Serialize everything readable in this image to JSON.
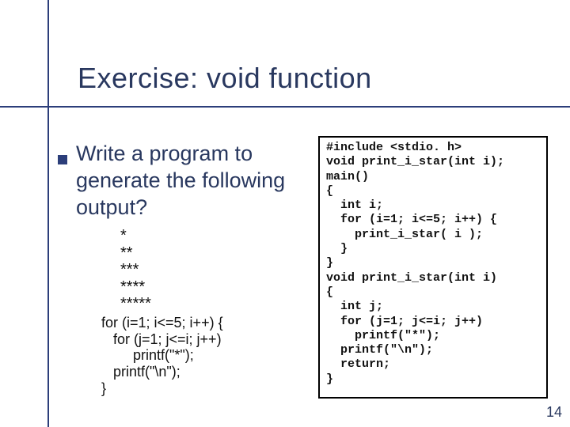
{
  "title": "Exercise: void function",
  "problem_text": "Write a program to generate the following output?",
  "stars_output": "*\n**\n***\n****\n*****",
  "left_snippet": "for (i=1; i<=5; i++) {\n   for (j=1; j<=i; j++)\n        printf(\"*\");\n   printf(\"\\n\");\n}",
  "code_box": "#include <stdio. h>\nvoid print_i_star(int i);\nmain()\n{\n  int i;\n  for (i=1; i<=5; i++) {\n    print_i_star( i );\n  }\n}\nvoid print_i_star(int i)\n{\n  int j;\n  for (j=1; j<=i; j++)\n    printf(\"*\");\n  printf(\"\\n\");\n  return;\n}",
  "page_number": "14"
}
